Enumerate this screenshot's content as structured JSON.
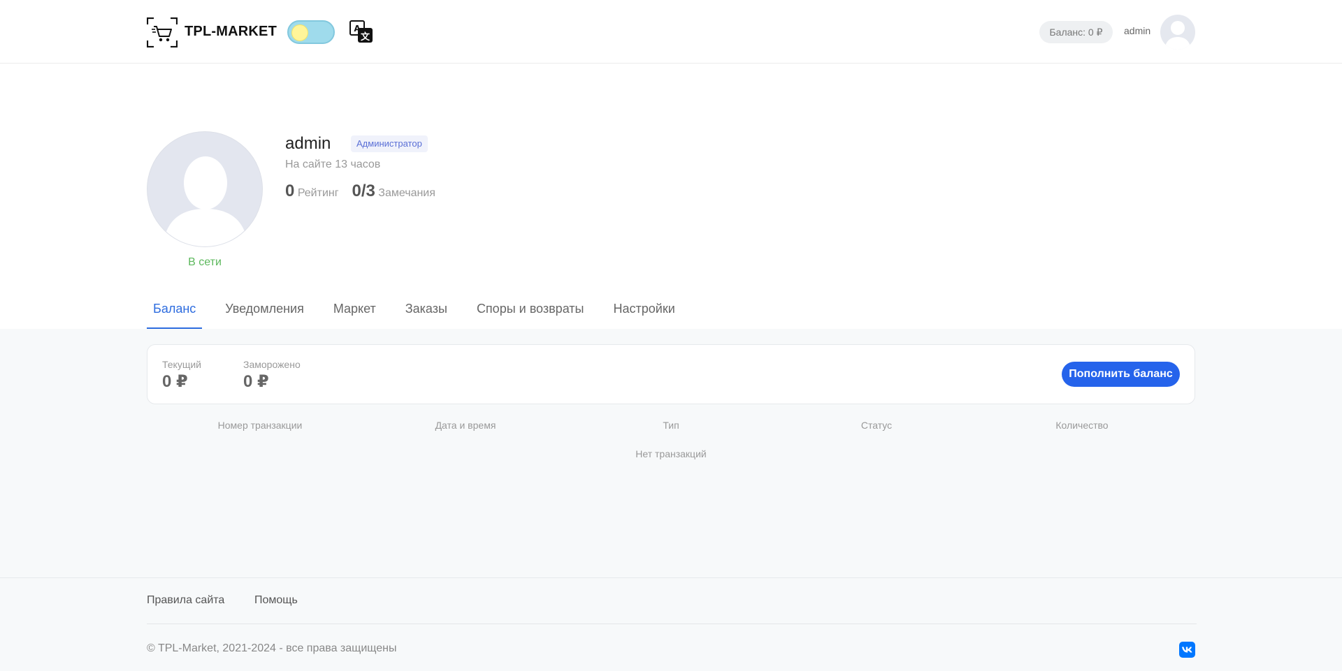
{
  "header": {
    "logo_text": "TPL-MARKET",
    "balance_label": "Баланс: 0 ₽",
    "username": "admin",
    "icons": [
      "cart-icon",
      "theme-toggle",
      "translate-icon",
      "avatar"
    ]
  },
  "profile": {
    "name": "admin",
    "role": "Администратор",
    "online_time": "На сайте 13 часов",
    "rating_value": "0",
    "rating_label": "Рейтинг",
    "warnings_value": "0/3",
    "warnings_label": "Замечания",
    "status": "В сети"
  },
  "tabs": [
    {
      "label": "Баланс",
      "active": true
    },
    {
      "label": "Уведомления"
    },
    {
      "label": "Маркет"
    },
    {
      "label": "Заказы"
    },
    {
      "label": "Споры и возвраты"
    },
    {
      "label": "Настройки"
    }
  ],
  "balance": {
    "current_label": "Текущий",
    "current_value": "0 ₽",
    "frozen_label": "Заморожено",
    "frozen_value": "0 ₽",
    "topup_label": "Пополнить баланс"
  },
  "transactions": {
    "columns": [
      "Номер транзакции",
      "Дата и время",
      "Тип",
      "Статус",
      "Количество"
    ],
    "empty_text": "Нет транзакций"
  },
  "footer": {
    "links": [
      "Правила сайта",
      "Помощь"
    ],
    "copyright": "© TPL-Market, 2021-2024 - все права защищены",
    "social_icon": "vk-icon"
  },
  "colors": {
    "accent": "#2563eb",
    "online": "#5cb85c",
    "role_badge": "#5a6fd6",
    "vk": "#0077ff"
  }
}
